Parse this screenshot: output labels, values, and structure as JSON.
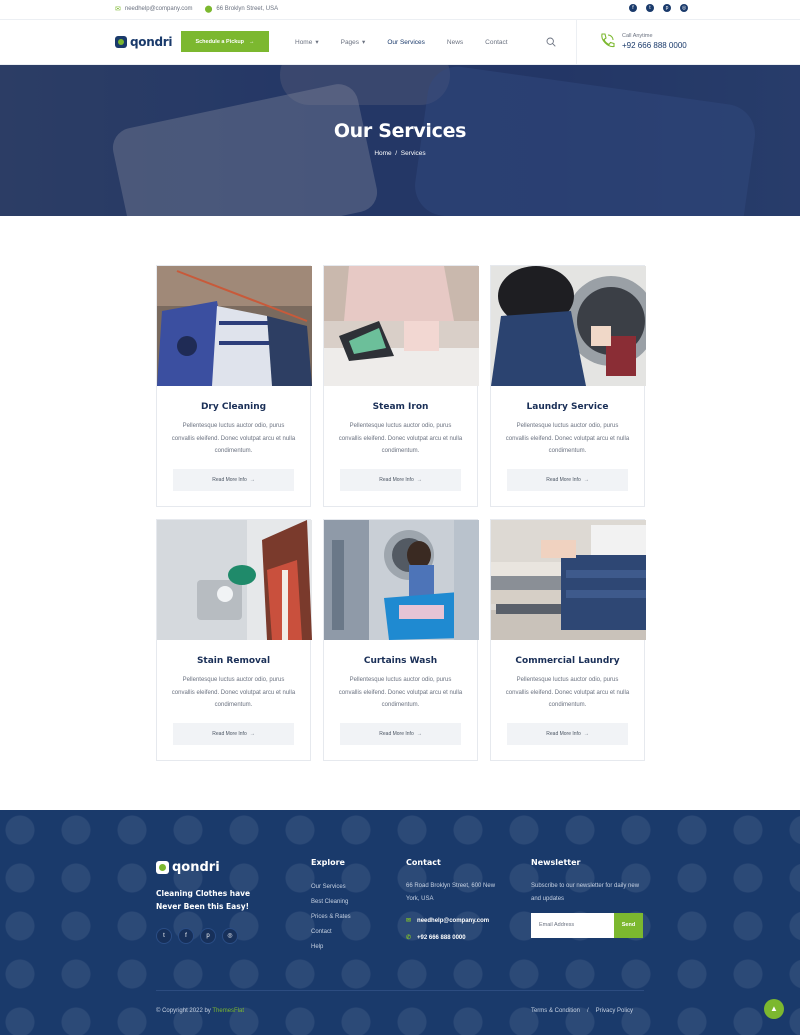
{
  "topbar": {
    "email": "needhelp@company.com",
    "address": "66 Broklyn Street, USA",
    "social": [
      "facebook",
      "twitter",
      "pinterest",
      "instagram"
    ]
  },
  "header": {
    "logo": "qondri",
    "pickup_button": "Schedule a Pickup",
    "nav": [
      {
        "label": "Home",
        "dropdown": true
      },
      {
        "label": "Pages",
        "dropdown": true
      },
      {
        "label": "Our Services",
        "dropdown": false
      },
      {
        "label": "News",
        "dropdown": false
      },
      {
        "label": "Contact",
        "dropdown": false
      }
    ],
    "call_label": "Call Anytime",
    "call_number": "+92 666 888 0000"
  },
  "hero": {
    "title": "Our Services",
    "breadcrumb_home": "Home",
    "breadcrumb_sep": "/",
    "breadcrumb_current": "Services"
  },
  "services": [
    {
      "title": "Dry Cleaning",
      "text": "Pellentesque luctus auctor odio, purus convallis eleifend. Donec volutpat arcu et nulla condimentum.",
      "button": "Read More Info"
    },
    {
      "title": "Steam Iron",
      "text": "Pellentesque luctus auctor odio, purus convallis eleifend. Donec volutpat arcu et nulla condimentum.",
      "button": "Read More Info"
    },
    {
      "title": "Laundry Service",
      "text": "Pellentesque luctus auctor odio, purus convallis eleifend. Donec volutpat arcu et nulla condimentum.",
      "button": "Read More Info"
    },
    {
      "title": "Stain Removal",
      "text": "Pellentesque luctus auctor odio, purus convallis eleifend. Donec volutpat arcu et nulla condimentum.",
      "button": "Read More Info"
    },
    {
      "title": "Curtains Wash",
      "text": "Pellentesque luctus auctor odio, purus convallis eleifend. Donec volutpat arcu et nulla condimentum.",
      "button": "Read More Info"
    },
    {
      "title": "Commercial Laundry",
      "text": "Pellentesque luctus auctor odio, purus convallis eleifend. Donec volutpat arcu et nulla condimentum.",
      "button": "Read More Info"
    }
  ],
  "footer": {
    "logo": "qondri",
    "tagline": "Cleaning Clothes have Never Been this Easy!",
    "explore_title": "Explore",
    "explore_links": [
      "Our Services",
      "Best Cleaning",
      "Prices & Rates",
      "Contact",
      "Help"
    ],
    "contact_title": "Contact",
    "contact_address": "66 Road Broklyn Street, 600 New York, USA",
    "contact_email": "needhelp@company.com",
    "contact_phone": "+92 666 888 0000",
    "newsletter_title": "Newsletter",
    "newsletter_text": "Subscribe to our newsletter for daily new and updates",
    "email_placeholder": "Email Address",
    "send_button": "Send",
    "copyright": "© Copyright 2022 by",
    "copyright_brand": "ThemesFlat",
    "terms": "Terms & Condition",
    "legal_sep": "/",
    "privacy": "Privacy Policy"
  },
  "colors": {
    "brand_navy": "#1a3a6b",
    "brand_green": "#7cb82f"
  }
}
